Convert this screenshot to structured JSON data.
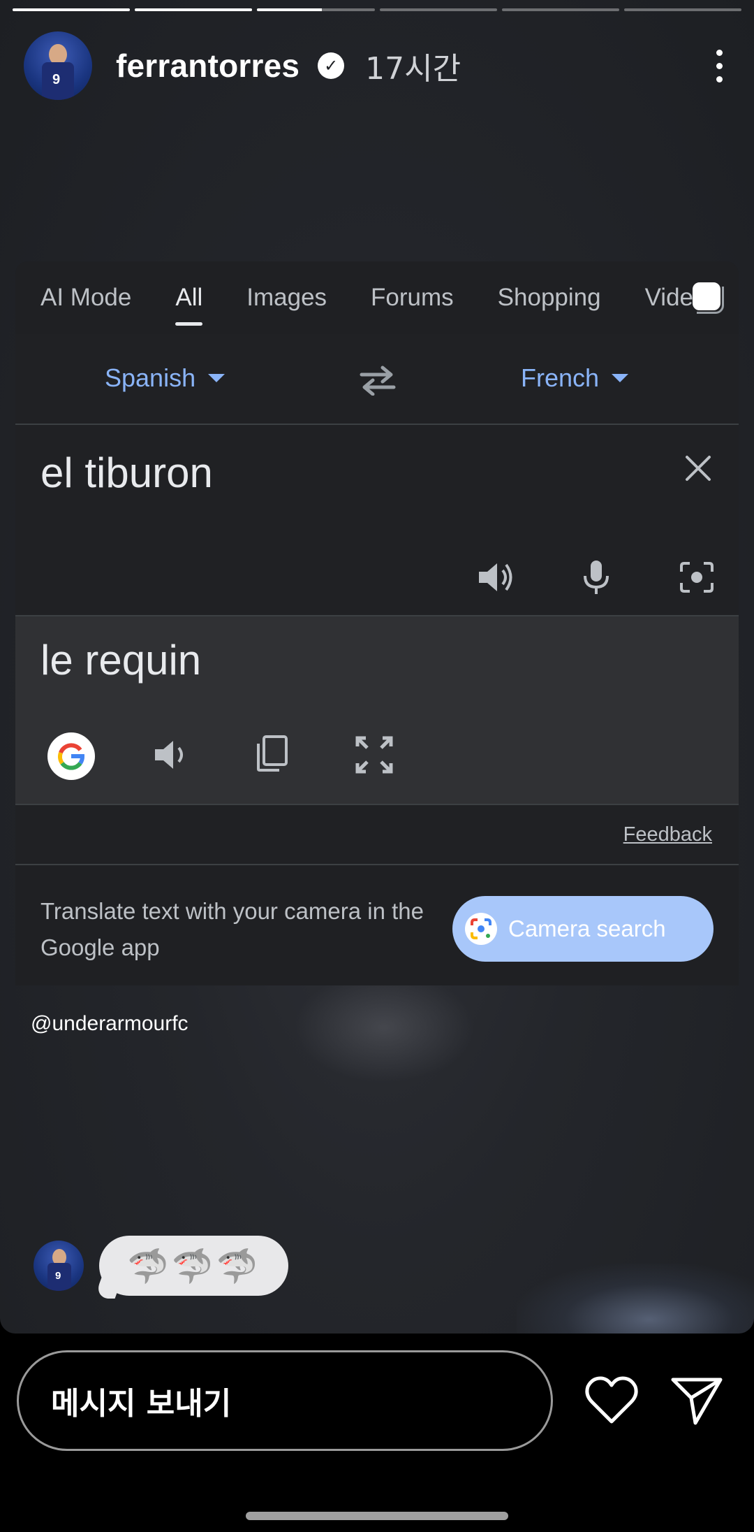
{
  "story": {
    "progress": [
      1,
      1,
      0.55,
      0,
      0,
      0
    ],
    "username": "ferrantorres",
    "time": "17시간",
    "mention": "@underarmourfc",
    "reply_emoji": "🦈🦈🦈"
  },
  "translate_card": {
    "tabs": [
      "AI Mode",
      "All",
      "Images",
      "Forums",
      "Shopping",
      "Videos"
    ],
    "active_tab": "All",
    "source_language": "Spanish",
    "target_language": "French",
    "input_text": "el tiburon",
    "output_text": "le requin",
    "feedback_label": "Feedback",
    "promo_text": "Translate text with your camera in the Google app",
    "camera_button_label": "Camera search",
    "accent_color": "#8ab4f8",
    "button_color": "#a8c7fa"
  },
  "footer": {
    "message_placeholder": "메시지 보내기"
  }
}
